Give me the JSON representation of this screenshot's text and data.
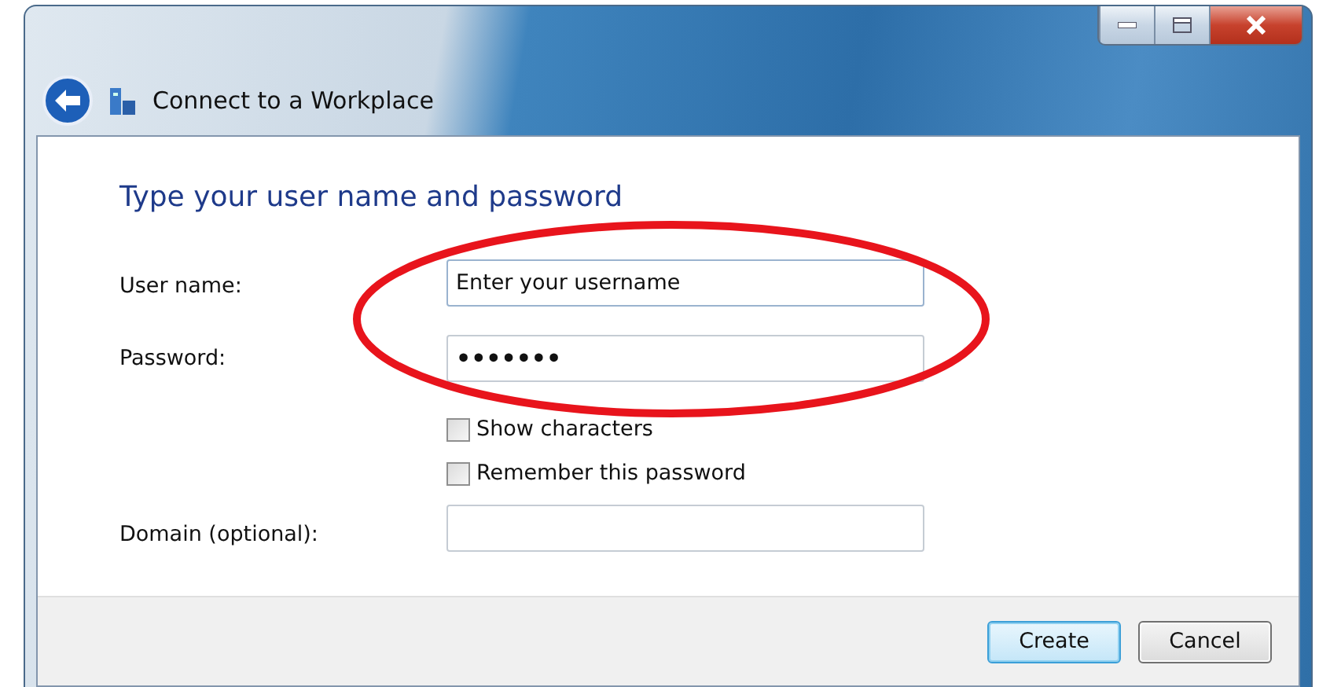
{
  "window": {
    "title": "Connect to a Workplace"
  },
  "heading": "Type your user name and password",
  "fields": [
    {
      "label": "User name:",
      "value": "Enter your username",
      "kind": "text"
    },
    {
      "label": "Password:",
      "value": "•••••••",
      "kind": "password"
    }
  ],
  "options": [
    {
      "label": "Show characters",
      "checked": false
    },
    {
      "label": "Remember this password",
      "checked": false
    }
  ],
  "domain": {
    "label": "Domain (optional):"
  },
  "buttons": [
    {
      "label": "Create",
      "default": true
    },
    {
      "label": "Cancel",
      "default": false
    }
  ]
}
